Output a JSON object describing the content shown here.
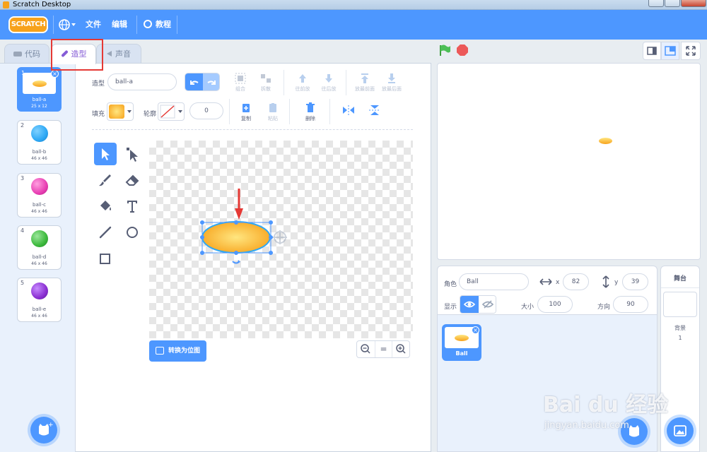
{
  "window": {
    "title": "Scratch Desktop"
  },
  "menubar": {
    "logo_text": "SCRATCH",
    "file_label": "文件",
    "edit_label": "编辑",
    "tutorials_label": "教程"
  },
  "tabs": {
    "code_label": "代码",
    "costumes_label": "造型",
    "sounds_label": "声音"
  },
  "costumes": [
    {
      "num": "1",
      "name": "ball-a",
      "size": "25 x 12",
      "color": "#ffcc33",
      "selected": true
    },
    {
      "num": "2",
      "name": "ball-b",
      "size": "46 x 46",
      "color": "#2da8f5",
      "selected": false
    },
    {
      "num": "3",
      "name": "ball-c",
      "size": "46 x 46",
      "color": "#e83fb3",
      "selected": false
    },
    {
      "num": "4",
      "name": "ball-d",
      "size": "46 x 46",
      "color": "#3cb93c",
      "selected": false
    },
    {
      "num": "5",
      "name": "ball-e",
      "size": "46 x 46",
      "color": "#8a2fd1",
      "selected": false
    }
  ],
  "paint": {
    "costume_label": "造型",
    "costume_name": "ball-a",
    "group_label": "组合",
    "ungroup_label": "拆散",
    "forward_label": "往前放",
    "backward_label": "往后放",
    "front_label": "放最前面",
    "back_label": "放最后面",
    "fill_label": "填充",
    "outline_label": "轮廓",
    "outline_width": "0",
    "copy_label": "复制",
    "paste_label": "粘贴",
    "delete_label": "删除",
    "convert_label": "转换为位图",
    "zoom_reset": "="
  },
  "sprite": {
    "sprite_label": "角色",
    "name": "Ball",
    "x_label": "x",
    "x": "82",
    "y_label": "y",
    "y": "39",
    "show_label": "显示",
    "size_label": "大小",
    "size": "100",
    "direction_label": "方向",
    "direction": "90",
    "tile_name": "Ball"
  },
  "stage": {
    "label": "舞台",
    "backdrops_label": "背景",
    "backdrops_count": "1"
  },
  "watermark": {
    "brand": "Bai du 经验",
    "url": "jingyan.baidu.com"
  },
  "colors": {
    "accent": "#4d97ff",
    "fill_gradient_start": "#ffe680",
    "fill_gradient_end": "#f7a21b",
    "annotation_red": "#e53935"
  }
}
